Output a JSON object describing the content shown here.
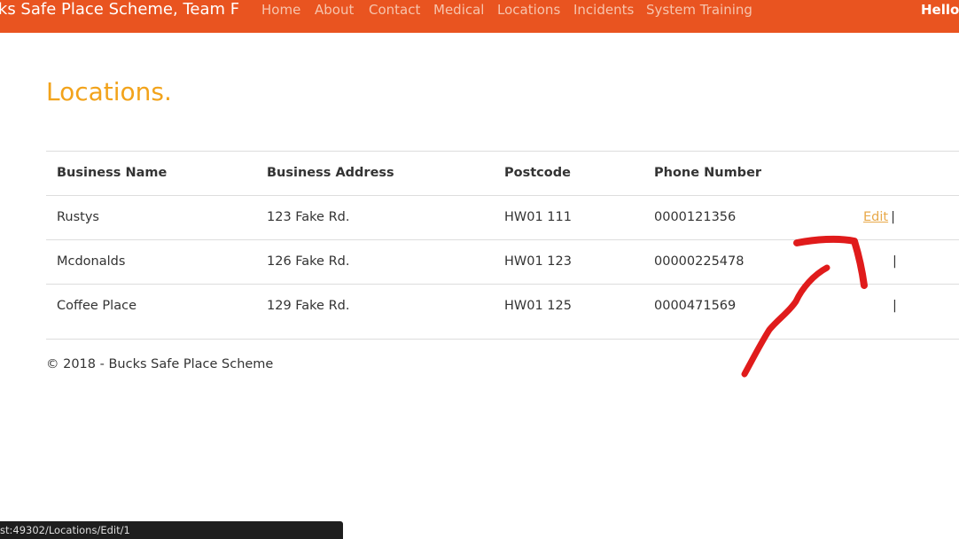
{
  "navbar": {
    "brand": "cks Safe Place Scheme, Team F",
    "links": [
      "Home",
      "About",
      "Contact",
      "Medical",
      "Locations",
      "Incidents",
      "System Training"
    ],
    "greeting": "Hello",
    "brand_color": "#e95420"
  },
  "page": {
    "title": "Locations."
  },
  "table": {
    "headers": [
      "Business Name",
      "Business Address",
      "Postcode",
      "Phone Number"
    ],
    "rows": [
      {
        "name": "Rustys",
        "address": "123 Fake Rd.",
        "postcode": "HW01 111",
        "phone": "0000121356",
        "action": "Edit",
        "separator": "|"
      },
      {
        "name": "Mcdonalds",
        "address": "126 Fake Rd.",
        "postcode": "HW01 123",
        "phone": "00000225478",
        "action": "",
        "separator": "|"
      },
      {
        "name": "Coffee Place",
        "address": "129 Fake Rd.",
        "postcode": "HW01 125",
        "phone": "0000471569",
        "action": "",
        "separator": "|"
      }
    ]
  },
  "footer": {
    "text": "© 2018 - Bucks Safe Place Scheme"
  },
  "status_bar": {
    "url": "st:49302/Locations/Edit/1"
  },
  "colors": {
    "title": "#f2a31b",
    "annotation": "#e01b1b",
    "link": "#e8a94a"
  }
}
